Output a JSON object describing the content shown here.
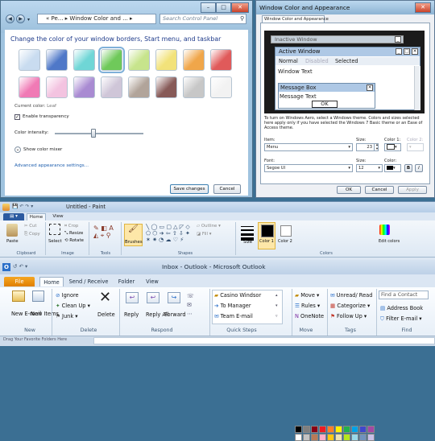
{
  "personalize": {
    "back": "◀",
    "forward": "▶",
    "breadcrumb": "« Pe... ▸ Window Color and ... ▸",
    "search_placeholder": "Search Control Panel",
    "heading": "Change the color of your window borders, Start menu, and taskbar",
    "swatches_row1": [
      "#c9dcf0",
      "#4f78c8",
      "#6fd6d6",
      "#6fc95a",
      "#c7e48c",
      "#f2e27a",
      "#f0a64a",
      "#e05a5a"
    ],
    "swatches_row2": [
      "#f07ab5",
      "#f3c3e0",
      "#a98bd2",
      "#cfc6d8",
      "#b1a49a",
      "#875a58",
      "#c7c7c7",
      "#f2f2f2"
    ],
    "current_color_label": "Current color:",
    "current_color_value": "Leaf",
    "transparency_label": "Enable transparency",
    "intensity_label": "Color intensity:",
    "mixer_label": "Show color mixer",
    "advanced_link": "Advanced appearance settings...",
    "save_button": "Save changes",
    "cancel_button": "Cancel"
  },
  "appearance": {
    "title": "Window Color and Appearance",
    "tab": "Window Color and Appearance",
    "inactive_window": "Inactive Window",
    "active_window": "Active Window",
    "menu_normal": "Normal",
    "menu_disabled": "Disabled",
    "menu_selected": "Selected",
    "window_text": "Window Text",
    "message_box": "Message Box",
    "message_text": "Message Text",
    "ok_preview": "OK",
    "description": "To turn on Windows Aero, select a Windows theme. Colors and sizes selected here apply only if you have selected the Windows 7 Basic theme or an Ease of Access theme.",
    "item_label": "Item:",
    "item_value": "Menu",
    "size_label": "Size:",
    "item_size": "23",
    "color1_label": "Color 1:",
    "color2_label": "Color 2:",
    "font_label": "Font:",
    "font_value": "Segoe UI",
    "font_size_label": "Size:",
    "font_size": "12",
    "font_color_label": "Color:",
    "bold": "B",
    "italic": "I",
    "ok_button": "OK",
    "cancel_button": "Cancel",
    "apply_button": "Apply"
  },
  "paint": {
    "title": "Untitled - Paint",
    "tab_home": "Home",
    "tab_view": "View",
    "paste": "Paste",
    "cut": "Cut",
    "copy": "Copy",
    "select": "Select",
    "crop": "Crop",
    "resize": "Resize",
    "rotate": "Rotate",
    "brushes": "Brushes",
    "outline": "Outline",
    "fill": "Fill",
    "size": "Size",
    "color1": "Color 1",
    "color2": "Color 2",
    "edit_colors": "Edit colors",
    "group_clipboard": "Clipboard",
    "group_image": "Image",
    "group_tools": "Tools",
    "group_shapes": "Shapes",
    "group_colors": "Colors",
    "palette": [
      "#000000",
      "#7f7f7f",
      "#880015",
      "#ed1c24",
      "#ff7f27",
      "#fff200",
      "#22b14c",
      "#00a2e8",
      "#3f48cc",
      "#a349a4",
      "#ffffff",
      "#c3c3c3",
      "#b97a57",
      "#ffaec9",
      "#ffc90e",
      "#efe4b0",
      "#b5e61d",
      "#99d9ea",
      "#7092be",
      "#c8bfe7"
    ]
  },
  "outlook": {
    "title": "Inbox - Outlook - Microsoft Outlook",
    "tabs": [
      "File",
      "Home",
      "Send / Receive",
      "Folder",
      "View"
    ],
    "new_email": "New E-mail",
    "new_items": "New Items",
    "ignore": "Ignore",
    "clean_up": "Clean Up",
    "junk": "Junk",
    "delete": "Delete",
    "reply": "Reply",
    "reply_all": "Reply All",
    "forward": "Forward",
    "qs_casino": "Casino Windsor",
    "qs_manager": "To Manager",
    "qs_team": "Team E-mail",
    "move": "Move",
    "rules": "Rules",
    "onenote": "OneNote",
    "unread_read": "Unread/ Read",
    "categorize": "Categorize",
    "follow_up": "Follow Up",
    "find_contact": "Find a Contact",
    "address_book": "Address Book",
    "filter_email": "Filter E-mail",
    "group_new": "New",
    "group_delete": "Delete",
    "group_respond": "Respond",
    "group_quick_steps": "Quick Steps",
    "group_move": "Move",
    "group_tags": "Tags",
    "group_find": "Find",
    "drag_hint": "Drag Your Favorite Folders Here"
  }
}
